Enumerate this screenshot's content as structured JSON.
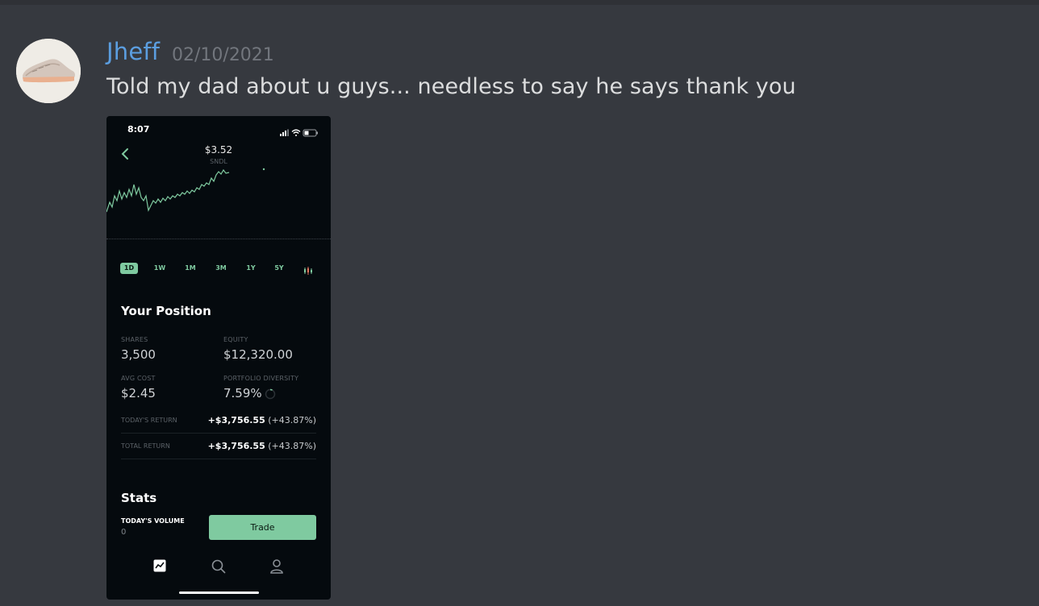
{
  "message": {
    "username": "Jheff",
    "timestamp": "02/10/2021",
    "text": "Told my dad about u guys... needless to say he says thank you"
  },
  "attachment": {
    "status_time": "8:07",
    "price": "$3.52",
    "ticker": "SNDL",
    "ranges": [
      "1D",
      "1W",
      "1M",
      "3M",
      "1Y",
      "5Y"
    ],
    "selected_range": "1D",
    "position": {
      "title": "Your Position",
      "shares_label": "SHARES",
      "shares": "3,500",
      "equity_label": "EQUITY",
      "equity": "$12,320.00",
      "avg_cost_label": "AVG COST",
      "avg_cost": "$2.45",
      "diversity_label": "PORTFOLIO DIVERSITY",
      "diversity": "7.59%",
      "todays_return_label": "TODAY'S RETURN",
      "todays_return_amount": "+$3,756.55",
      "todays_return_pct": "(+43.87%)",
      "total_return_label": "TOTAL RETURN",
      "total_return_amount": "+$3,756.55",
      "total_return_pct": "(+43.87%)"
    },
    "stats": {
      "title": "Stats",
      "volume_label": "TODAY'S VOLUME",
      "volume": "0"
    },
    "trade_label": "Trade",
    "colors": {
      "accent": "#7fcaa0",
      "background": "#050a0e"
    },
    "nav_icons": [
      "chart-icon",
      "search-icon",
      "account-icon"
    ]
  }
}
